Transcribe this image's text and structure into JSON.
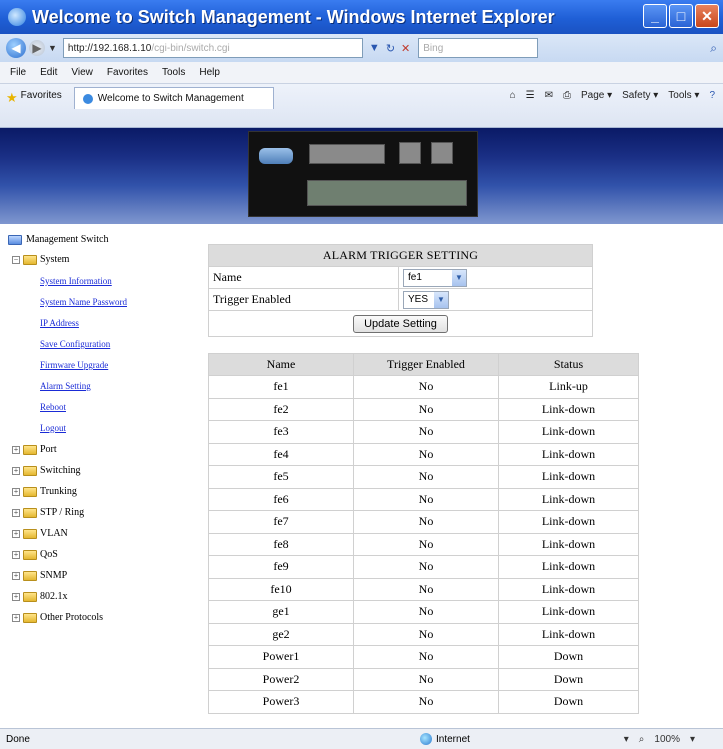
{
  "window": {
    "title": "Welcome to Switch Management - Windows Internet Explorer",
    "minimize": "_",
    "maximize": "□",
    "close": "✕"
  },
  "address": {
    "url_host": "http://192.168.1.10",
    "url_path": "/cgi-bin/switch.cgi",
    "search_placeholder": "Bing"
  },
  "menu": [
    "File",
    "Edit",
    "View",
    "Favorites",
    "Tools",
    "Help"
  ],
  "favorites": {
    "label": "Favorites",
    "tab_title": "Welcome to Switch Management",
    "commands": [
      "Page ▾",
      "Safety ▾",
      "Tools ▾"
    ]
  },
  "sidebar": {
    "root": "Management Switch",
    "system": "System",
    "system_links": [
      "System Information",
      "System Name Password",
      "IP Address",
      "Save Configuration",
      "Firmware Upgrade",
      "Alarm Setting",
      "Reboot",
      "Logout"
    ],
    "groups": [
      "Port",
      "Switching",
      "Trunking",
      "STP / Ring",
      "VLAN",
      "QoS",
      "SNMP",
      "802.1x",
      "Other Protocols"
    ]
  },
  "alarm": {
    "header": "ALARM TRIGGER SETTING",
    "name_label": "Name",
    "name_value": "fe1",
    "trigger_label": "Trigger Enabled",
    "trigger_value": "YES",
    "update_button": "Update Setting"
  },
  "status_table": {
    "columns": [
      "Name",
      "Trigger Enabled",
      "Status"
    ],
    "rows": [
      [
        "fe1",
        "No",
        "Link-up"
      ],
      [
        "fe2",
        "No",
        "Link-down"
      ],
      [
        "fe3",
        "No",
        "Link-down"
      ],
      [
        "fe4",
        "No",
        "Link-down"
      ],
      [
        "fe5",
        "No",
        "Link-down"
      ],
      [
        "fe6",
        "No",
        "Link-down"
      ],
      [
        "fe7",
        "No",
        "Link-down"
      ],
      [
        "fe8",
        "No",
        "Link-down"
      ],
      [
        "fe9",
        "No",
        "Link-down"
      ],
      [
        "fe10",
        "No",
        "Link-down"
      ],
      [
        "ge1",
        "No",
        "Link-down"
      ],
      [
        "ge2",
        "No",
        "Link-down"
      ],
      [
        "Power1",
        "No",
        "Down"
      ],
      [
        "Power2",
        "No",
        "Down"
      ],
      [
        "Power3",
        "No",
        "Down"
      ]
    ]
  },
  "statusbar": {
    "left": "Done",
    "zone": "Internet",
    "zoom": "100%"
  }
}
